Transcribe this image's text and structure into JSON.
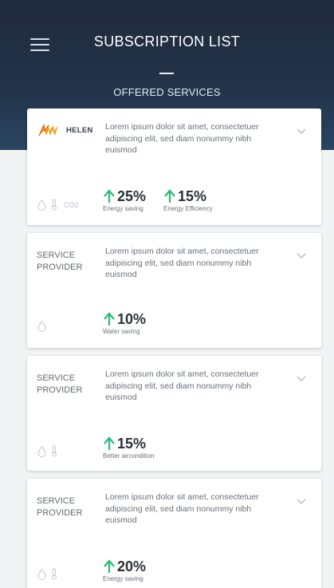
{
  "header": {
    "title": "SUBSCRIPTION LIST",
    "subtitle": "OFFERED SERVICES"
  },
  "colors": {
    "header_bg": "#22344a",
    "accent_green": "#2fb87a"
  },
  "cards": [
    {
      "provider_logo": "HELEN",
      "description": "Lorem ipsum dolor sit amet, consectetuer adipiscing elit, sed diam nonummy nibh euismod",
      "icons": [
        "water-drop-icon",
        "thermometer-icon"
      ],
      "co2_label": "CO2",
      "metrics": [
        {
          "value": "25%",
          "label": "Energy saving"
        },
        {
          "value": "15%",
          "label": "Energy Efficiency"
        }
      ]
    },
    {
      "provider_line1": "SERVICE",
      "provider_line2": "PROVIDER",
      "description": "Lorem ipsum dolor sit amet, consectetuer adipiscing elit, sed diam nonummy nibh euismod",
      "icons": [
        "water-drop-icon"
      ],
      "metrics": [
        {
          "value": "10%",
          "label": "Water saving"
        }
      ]
    },
    {
      "provider_line1": "SERVICE",
      "provider_line2": "PROVIDER",
      "description": "Lorem ipsum dolor sit amet, consectetuer adipiscing elit, sed diam nonummy nibh euismod",
      "icons": [
        "water-drop-icon",
        "thermometer-icon"
      ],
      "metrics": [
        {
          "value": "15%",
          "label": "Better aircondition"
        }
      ]
    },
    {
      "provider_line1": "SERVICE",
      "provider_line2": "PROVIDER",
      "description": "Lorem ipsum dolor sit amet, consectetuer adipiscing elit, sed diam nonummy nibh euismod",
      "icons": [
        "water-drop-icon",
        "thermometer-icon"
      ],
      "metrics": [
        {
          "value": "20%",
          "label": "Energy saving"
        }
      ]
    }
  ]
}
